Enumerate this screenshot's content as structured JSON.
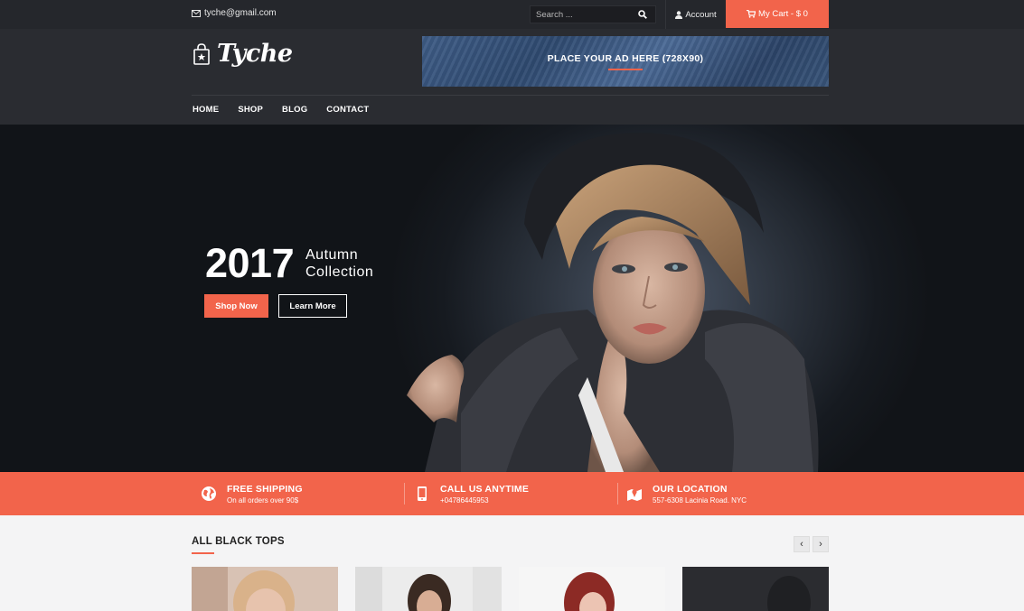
{
  "topbar": {
    "email": "tyche@gmail.com",
    "search_placeholder": "Search ...",
    "account_label": "Account",
    "cart_label": "My Cart - $ 0"
  },
  "header": {
    "logo_text": "Tyche",
    "ad_text": "PLACE YOUR AD HERE (728X90)",
    "nav": [
      "HOME",
      "SHOP",
      "BLOG",
      "CONTACT"
    ]
  },
  "hero": {
    "year": "2017",
    "subtitle_line1": "Autumn",
    "subtitle_line2": "Collection",
    "shop_button": "Shop Now",
    "learn_button": "Learn More"
  },
  "features": [
    {
      "icon": "globe-icon",
      "title": "FREE SHIPPING",
      "desc": "On all orders over 90$"
    },
    {
      "icon": "phone-icon",
      "title": "CALL US ANYTIME",
      "desc": "+04786445953"
    },
    {
      "icon": "map-icon",
      "title": "OUR LOCATION",
      "desc": "557-6308 Lacinia Road. NYC"
    }
  ],
  "section": {
    "title": "ALL BLACK TOPS",
    "prev": "‹",
    "next": "›"
  },
  "colors": {
    "accent": "#f2644b",
    "topbar": "#25272c",
    "header": "#2a2c31"
  }
}
